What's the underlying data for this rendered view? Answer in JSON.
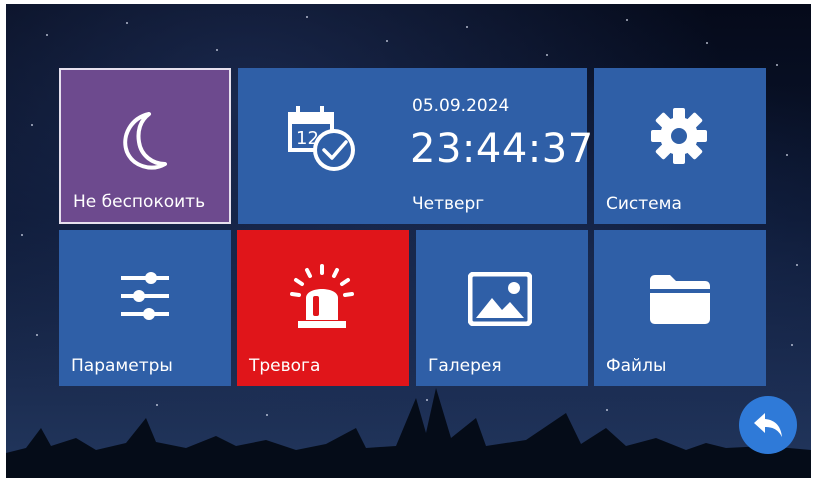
{
  "tiles": {
    "do_not_disturb": {
      "label": "Не беспокоить",
      "icon": "moon-icon",
      "color": "#6d4a8e"
    },
    "clock": {
      "date": "05.09.2024",
      "time": "23:44:37",
      "weekday": "Четверг",
      "icon": "calendar-clock-icon",
      "color": "#2f5fa7"
    },
    "system": {
      "label": "Система",
      "icon": "gear-icon",
      "color": "#2f5fa7"
    },
    "parameters": {
      "label": "Параметры",
      "icon": "sliders-icon",
      "color": "#2f5fa7"
    },
    "alarm": {
      "label": "Тревога",
      "icon": "siren-icon",
      "color": "#e0151a"
    },
    "gallery": {
      "label": "Галерея",
      "icon": "image-icon",
      "color": "#2f5fa7"
    },
    "files": {
      "label": "Файлы",
      "icon": "folder-icon",
      "color": "#2f5fa7"
    }
  },
  "back_button": {
    "icon": "back-arrow-icon",
    "color": "#2f7ad8"
  }
}
